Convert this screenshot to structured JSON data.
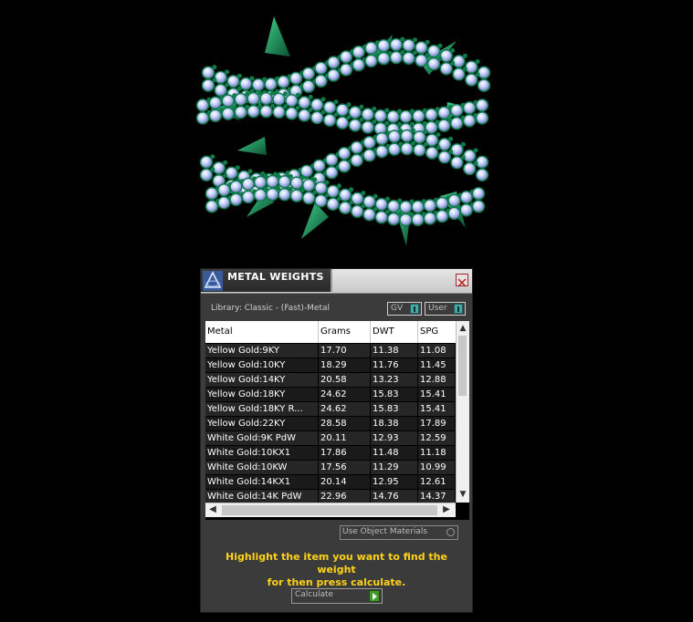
{
  "panel": {
    "title": "METAL WEIGHTS",
    "library_label": "Library: Classic - (Fast)-Metal",
    "toggles": {
      "gv": "GV",
      "user": "User"
    },
    "use_object_materials": "Use Object Materials",
    "instruction_line1": "Highlight the item you want to find the weight",
    "instruction_line2": "for then press calculate.",
    "calculate_label": "Calculate"
  },
  "table": {
    "columns": [
      "Metal",
      "Grams",
      "DWT",
      "SPG"
    ],
    "rows": [
      [
        "Yellow Gold:9KY",
        "17.70",
        "11.38",
        "11.08"
      ],
      [
        "Yellow Gold:10KY",
        "18.29",
        "11.76",
        "11.45"
      ],
      [
        "Yellow Gold:14KY",
        "20.58",
        "13.23",
        "12.88"
      ],
      [
        "Yellow Gold:18KY",
        "24.62",
        "15.83",
        "15.41"
      ],
      [
        "Yellow Gold:18KY R...",
        "24.62",
        "15.83",
        "15.41"
      ],
      [
        "Yellow Gold:22KY",
        "28.58",
        "18.38",
        "17.89"
      ],
      [
        "White Gold:9K PdW",
        "20.11",
        "12.93",
        "12.59"
      ],
      [
        "White Gold:10KX1",
        "17.86",
        "11.48",
        "11.18"
      ],
      [
        "White Gold:10KW",
        "17.56",
        "11.29",
        "10.99"
      ],
      [
        "White Gold:14KX1",
        "20.14",
        "12.95",
        "12.61"
      ],
      [
        "White Gold:14K PdW",
        "22.96",
        "14.76",
        "14.37"
      ]
    ]
  },
  "icons": {
    "logo": "matrix-logo-icon",
    "close": "close-icon"
  },
  "colors": {
    "instruction": "#ffd21a",
    "knob": "#49a8a8",
    "go": "#3f9a2a",
    "gem": "#c8d2ff",
    "metal": "#0f7a4a"
  }
}
